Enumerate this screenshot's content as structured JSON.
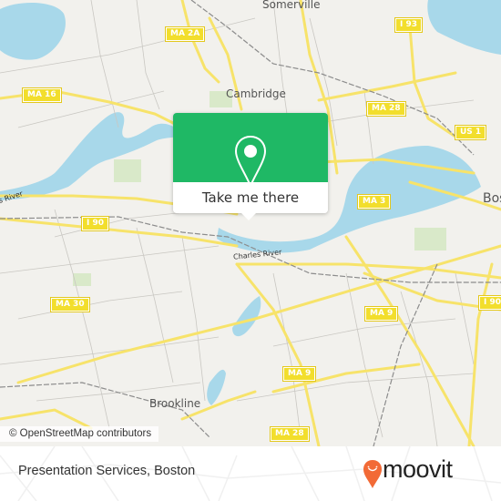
{
  "map": {
    "place_labels": {
      "somerville": "Somerville",
      "cambridge": "Cambridge",
      "boston": "Bos",
      "brookline": "Brookline",
      "charles_river_main": "Charles River",
      "charles_river_west": "s River"
    },
    "road_shields": {
      "ma2a": "MA 2A",
      "ma16": "MA 16",
      "i93": "I 93",
      "ma28_north": "MA 28",
      "us1": "US 1",
      "ma3": "MA 3",
      "i90_west": "I 90",
      "i90_east": "I 90",
      "ma30": "MA 30",
      "ma9_east": "MA 9",
      "ma9_south": "MA 9",
      "ma28_south": "MA 28"
    },
    "colors": {
      "land": "#f2f1ed",
      "water": "#a8d8ea",
      "road": "#f7e36a",
      "park": "#d9e9c9",
      "rail": "#8c8c8c"
    }
  },
  "popup": {
    "icon": "map-pin-icon",
    "action_label": "Take me there",
    "accent": "#1fb865"
  },
  "attribution": "© OpenStreetMap contributors",
  "footer": {
    "place_title": "Presentation Services, Boston",
    "brand": "moovit",
    "brand_color": "#f26a36"
  }
}
